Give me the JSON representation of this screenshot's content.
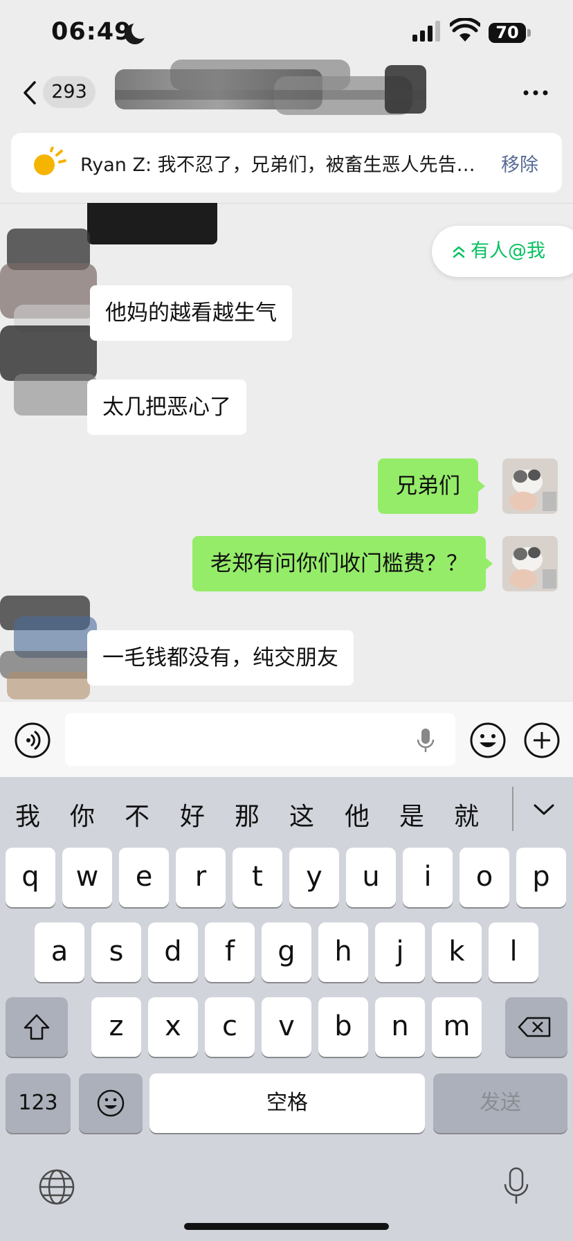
{
  "status_bar": {
    "time": "06:49",
    "battery": "70"
  },
  "nav": {
    "unread_count": "293"
  },
  "notice": {
    "text": "Ryan Z: 我不忍了，兄弟们，被畜生恶人先告…",
    "remove_label": "移除"
  },
  "mention": {
    "label": "有人@我"
  },
  "messages": [
    {
      "side": "left",
      "text": "他妈的越看越生气"
    },
    {
      "side": "left",
      "text": "太几把恶心了"
    },
    {
      "side": "right",
      "text": "兄弟们"
    },
    {
      "side": "right",
      "text": "老郑有问你们收门槛费？？"
    },
    {
      "side": "left",
      "text": "一毛钱都没有，纯交朋友"
    }
  ],
  "keyboard": {
    "candidates": [
      "我",
      "你",
      "不",
      "好",
      "那",
      "这",
      "他",
      "是",
      "就"
    ],
    "row1": [
      "q",
      "w",
      "e",
      "r",
      "t",
      "y",
      "u",
      "i",
      "o",
      "p"
    ],
    "row2": [
      "a",
      "s",
      "d",
      "f",
      "g",
      "h",
      "j",
      "k",
      "l"
    ],
    "row3": [
      "z",
      "x",
      "c",
      "v",
      "b",
      "n",
      "m"
    ],
    "numbers_label": "123",
    "space_label": "空格",
    "send_label": "发送"
  },
  "colors": {
    "accent_green": "#07c160",
    "bubble_green": "#95ec69",
    "link_blue": "#576b95"
  },
  "icons": [
    "moon-icon",
    "signal-icon",
    "wifi-icon",
    "back-icon",
    "more-icon",
    "sun-icon",
    "voice-icon",
    "mic-icon",
    "emoji-icon",
    "plus-icon",
    "shift-icon",
    "delete-icon",
    "globe-icon",
    "chevron-down-icon"
  ]
}
